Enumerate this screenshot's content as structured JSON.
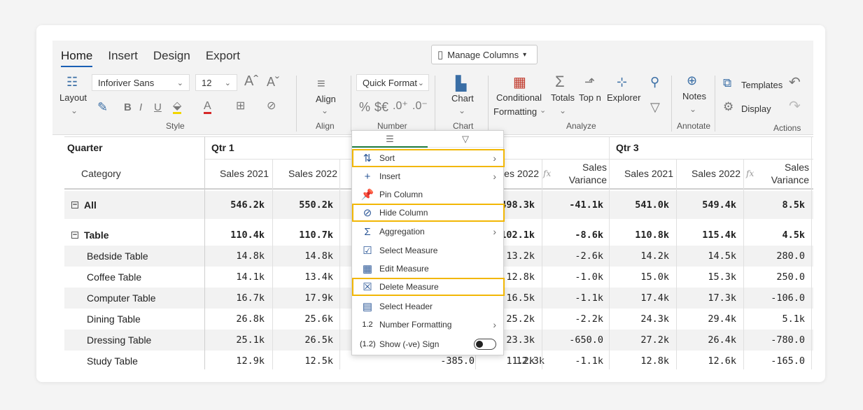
{
  "ribbon": {
    "tabs": [
      "Home",
      "Insert",
      "Design",
      "Export"
    ],
    "manage_columns": "Manage Columns",
    "layout": "Layout",
    "font": "Inforiver Sans",
    "font_size": "12",
    "align": "Align",
    "quick_format": "Quick Format",
    "chart": "Chart",
    "conditional": "Conditional",
    "formatting": "Formatting",
    "totals": "Totals",
    "topn": "Top n",
    "explorer": "Explorer",
    "notes": "Notes",
    "templates": "Templates",
    "display": "Display",
    "groups": {
      "style": "Style",
      "align": "Align",
      "number": "Number",
      "chart": "Chart",
      "analyze": "Analyze",
      "annotate": "Annotate",
      "actions": "Actions"
    }
  },
  "table": {
    "quarter_header": "Quarter",
    "category_header": "Category",
    "qtr1": "Qtr 1",
    "qtr3": "Qtr 3",
    "col_sales2021": "Sales 2021",
    "col_sales2022": "Sales 2022",
    "col_sales2022_cut": "ales 2022",
    "col_sales": "Sales",
    "col_variance": "Variance",
    "fx": "fx",
    "rows": [
      {
        "label": "All",
        "bold": true,
        "toggle": "⊟",
        "indent": 0,
        "v": [
          "546.2k",
          "550.2k",
          "498.3k",
          "-41.1k",
          "541.0k",
          "549.4k",
          "8.5k"
        ]
      },
      {
        "label": "Table",
        "bold": true,
        "toggle": "⊟",
        "indent": 0,
        "v": [
          "110.4k",
          "110.7k",
          "102.1k",
          "-8.6k",
          "110.8k",
          "115.4k",
          "4.5k"
        ]
      },
      {
        "label": "Bedside Table",
        "indent": 1,
        "v": [
          "14.8k",
          "14.8k",
          "13.2k",
          "-2.6k",
          "14.2k",
          "14.5k",
          "280.0"
        ]
      },
      {
        "label": "Coffee Table",
        "indent": 1,
        "v": [
          "14.1k",
          "13.4k",
          "12.8k",
          "-1.0k",
          "15.0k",
          "15.3k",
          "250.0"
        ]
      },
      {
        "label": "Computer Table",
        "indent": 1,
        "v": [
          "16.7k",
          "17.9k",
          "16.5k",
          "-1.1k",
          "17.4k",
          "17.3k",
          "-106.0"
        ]
      },
      {
        "label": "Dining Table",
        "indent": 1,
        "v": [
          "26.8k",
          "25.6k",
          "25.2k",
          "-2.2k",
          "24.3k",
          "29.4k",
          "5.1k"
        ]
      },
      {
        "label": "Dressing Table",
        "indent": 1,
        "v": [
          "25.1k",
          "26.5k",
          "23.3k",
          "-650.0",
          "27.2k",
          "26.4k",
          "-780.0"
        ]
      },
      {
        "label": "Study Table",
        "indent": 1,
        "v": [
          "12.9k",
          "12.5k",
          "11.2k",
          "-1.1k",
          "12.8k",
          "12.6k",
          "-165.0"
        ]
      }
    ],
    "study_hidden_a": "-385.0",
    "study_hidden_b": "12.3k"
  },
  "menu": {
    "items": [
      {
        "label": "Sort",
        "icon": "sort-icon",
        "glyph": "⇅",
        "arrow": true,
        "highlight": true
      },
      {
        "label": "Insert",
        "icon": "plus-icon",
        "glyph": "+",
        "arrow": true
      },
      {
        "label": "Pin Column",
        "icon": "pin-icon",
        "glyph": "📌"
      },
      {
        "label": "Hide Column",
        "icon": "eye-hide-icon",
        "glyph": "⊘",
        "highlight": true
      },
      {
        "label": "Aggregation",
        "icon": "sigma-icon",
        "glyph": "Σ",
        "arrow": true
      },
      {
        "label": "Select Measure",
        "icon": "select-measure-icon",
        "glyph": "☑"
      },
      {
        "label": "Edit Measure",
        "icon": "calculator-icon",
        "glyph": "▦"
      },
      {
        "label": "Delete Measure",
        "icon": "delete-icon",
        "glyph": "☒",
        "highlight": true
      },
      {
        "label": "Select Header",
        "icon": "header-icon",
        "glyph": "▤"
      },
      {
        "label": "Number Formatting",
        "icon": "number-format-icon",
        "glyph": "1.2",
        "arrow": true
      },
      {
        "label": "Show (-ve) Sign",
        "icon": "negative-sign-icon",
        "glyph": "(1.2)",
        "toggle": true
      }
    ]
  },
  "colors": {
    "highlight": "#f2b705",
    "accent": "#1a5fb4",
    "icon": "#3a6ea5"
  }
}
